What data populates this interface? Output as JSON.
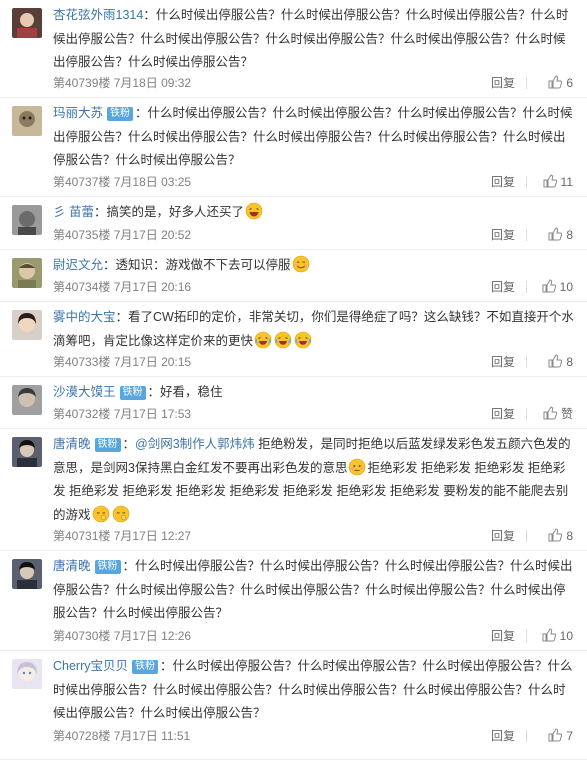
{
  "comments": [
    {
      "username": "杏花弦外雨1314",
      "badge": "",
      "mention": "",
      "text": "：什么时候出停服公告？什么时候出停服公告？什么时候出停服公告？什么时候出停服公告？什么时候出停服公告？什么时候出停服公告？什么时候出停服公告？什么时候出停服公告？什么时候出停服公告？",
      "text_after": "",
      "floor": "第40739楼",
      "date": "7月18日 09:32",
      "reply": "回复",
      "likes": "6",
      "avatar_color": "#5a3e3a"
    },
    {
      "username": "玛丽大苏",
      "badge": "铁粉",
      "mention": "",
      "text": "：什么时候出停服公告？什么时候出停服公告？什么时候出停服公告？什么时候出停服公告？什么时候出停服公告？什么时候出停服公告？什么时候出停服公告？什么时候出停服公告？什么时候出停服公告？",
      "text_after": "",
      "floor": "第40737楼",
      "date": "7月18日 03:25",
      "reply": "回复",
      "likes": "11",
      "avatar_color": "#8a7a60"
    },
    {
      "username": "彡 苗蕾",
      "badge": "",
      "mention": "",
      "text": "：搞笑的是，好多人还买了",
      "text_after": "",
      "floor": "第40735楼",
      "date": "7月17日 20:52",
      "reply": "回复",
      "likes": "8",
      "avatar_color": "#6b6b6b"
    },
    {
      "username": "尉迟文允",
      "badge": "",
      "mention": "",
      "text": "：透知识：游戏做不下去可以停服",
      "text_after": "",
      "floor": "第40734楼",
      "date": "7月17日 20:16",
      "reply": "回复",
      "likes": "10",
      "avatar_color": "#7a7a55"
    },
    {
      "username": "雾中的大宝",
      "badge": "",
      "mention": "",
      "text": "：看了CW拓印的定价，非常关切，你们是得绝症了吗？这么缺钱？不如直接开个水滴筹吧，肯定比像这样定价来的更快",
      "text_after": "",
      "floor": "第40733楼",
      "date": "7月17日 20:15",
      "reply": "回复",
      "likes": "8",
      "avatar_color": "#3a2a2a"
    },
    {
      "username": "沙漠大馍王",
      "badge": "铁粉",
      "mention": "",
      "text": "：好看，稳住",
      "text_after": "",
      "floor": "第40732楼",
      "date": "7月17日 17:53",
      "reply": "回复",
      "likes": "赞",
      "avatar_color": "#5a5a5a"
    },
    {
      "username": "唐清晚",
      "badge": "铁粉",
      "mention": "@剑网3制作人郭炜炜",
      "text": "：",
      "text_after": " 拒绝粉发，是同时拒绝以后蓝发绿发彩色发五颜六色发的意思，是剑网3保持黑白金红发不要再出彩色发的意思",
      "text_tail": "拒绝彩发 拒绝彩发 拒绝彩发 拒绝彩发 拒绝彩发 拒绝彩发 拒绝彩发 拒绝彩发 拒绝彩发 拒绝彩发 拒绝彩发 要粉发的能不能爬去别的游戏",
      "floor": "第40731楼",
      "date": "7月17日 12:27",
      "reply": "回复",
      "likes": "8",
      "avatar_color": "#2a2f3a"
    },
    {
      "username": "唐清晚",
      "badge": "铁粉",
      "mention": "",
      "text": "：什么时候出停服公告？什么时候出停服公告？什么时候出停服公告？什么时候出停服公告？什么时候出停服公告？什么时候出停服公告？什么时候出停服公告？什么时候出停服公告？什么时候出停服公告？",
      "text_after": "",
      "floor": "第40730楼",
      "date": "7月17日 12:26",
      "reply": "回复",
      "likes": "10",
      "avatar_color": "#2a2f3a"
    },
    {
      "username": "Cherry宝贝贝",
      "badge": "铁粉",
      "mention": "",
      "text": "：什么时候出停服公告？什么时候出停服公告？什么时候出停服公告？什么时候出停服公告？什么时候出停服公告？什么时候出停服公告？什么时候出停服公告？什么时候出停服公告？什么时候出停服公告？",
      "text_after": "",
      "floor": "第40728楼",
      "date": "7月17日 11:51",
      "reply": "回复",
      "likes": "7",
      "avatar_color": "#c8c0d8"
    }
  ]
}
